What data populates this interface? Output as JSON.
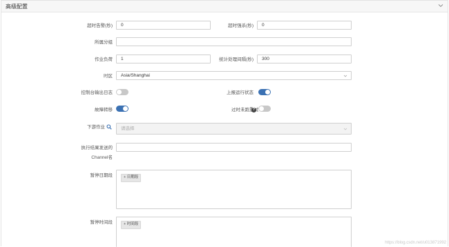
{
  "panel": {
    "title": "高级配置"
  },
  "fields": {
    "timeout_alarm": {
      "label": "超时告警(秒)",
      "value": "0"
    },
    "timeout_kill": {
      "label": "超时强杀(秒)",
      "value": "0"
    },
    "group": {
      "label": "所属分组",
      "value": ""
    },
    "job_load": {
      "label": "作业负荷",
      "value": "1"
    },
    "stat_interval": {
      "label": "统计处理间隔(秒)",
      "value": "300"
    },
    "timezone": {
      "label": "时区",
      "value": "Asia/Shanghai"
    },
    "console_log": {
      "label": "控制台输出日志",
      "on": false
    },
    "report_status": {
      "label": "上报运行状态",
      "on": true
    },
    "failover": {
      "label": "故障转移",
      "on": true
    },
    "rerun": {
      "label": "过时未跑重试",
      "on": false
    },
    "downstream": {
      "label": "下游作业",
      "placeholder": "请选择"
    },
    "channel": {
      "label_line1": "执行结果发送的",
      "label_line2": "Channel名",
      "value": ""
    },
    "pause_dates": {
      "label": "暂停日期段",
      "button": "+ 日期段"
    },
    "pause_times": {
      "label": "暂停时间段",
      "button": "+ 时间段"
    }
  },
  "watermark": "https://blog.csdn.net/u013871992"
}
